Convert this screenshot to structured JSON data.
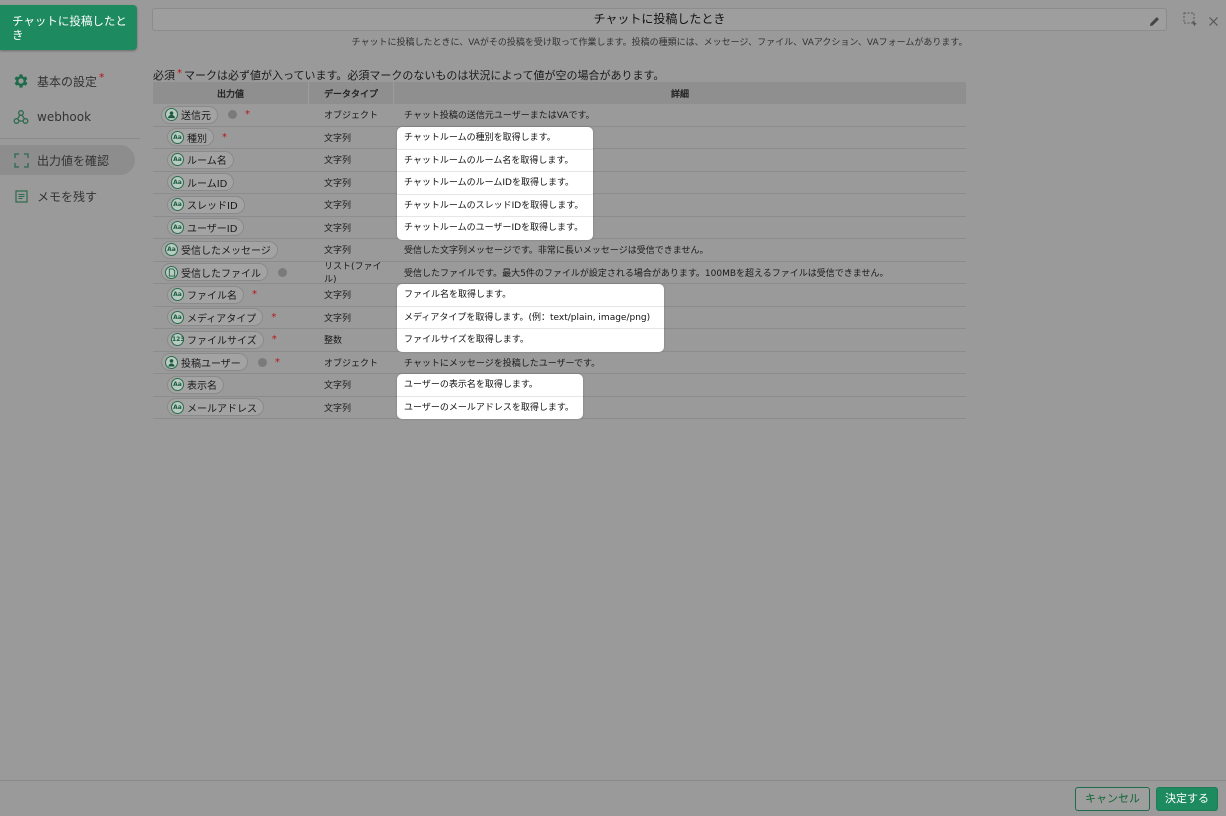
{
  "sidebar": {
    "trigger_title": "チャットに投稿したとき",
    "items": [
      {
        "label": "基本の設定",
        "required_mark": "*"
      },
      {
        "label": "webhook"
      },
      {
        "label": "出力値を確認"
      },
      {
        "label": "メモを残す"
      }
    ]
  },
  "header": {
    "title": "チャットに投稿したとき",
    "subtitle": "チャットに投稿したときに、VAがその投稿を受け取って作業します。投稿の種類には、メッセージ、ファイル、VAアクション、VAフォームがあります。"
  },
  "note": {
    "prefix": "必須",
    "mark": "*",
    "text": "マークは必ず値が入っています。必須マークのないものは状況によって値が空の場合があります。"
  },
  "table": {
    "headers": [
      "出力値",
      "データタイプ",
      "詳細"
    ],
    "rows": [
      {
        "name": "送信元",
        "icon": "group",
        "dot": true,
        "req": "*",
        "type": "オブジェクト",
        "detail": "チャット投稿の送信元ユーザーまたはVAです。",
        "indent": 0
      },
      {
        "name": "種別",
        "icon": "Aa",
        "req": "*",
        "type": "文字列",
        "detail": "",
        "indent": 1
      },
      {
        "name": "ルーム名",
        "icon": "Aa",
        "type": "文字列",
        "detail": "",
        "indent": 1
      },
      {
        "name": "ルームID",
        "icon": "Aa",
        "type": "文字列",
        "detail": "",
        "indent": 1
      },
      {
        "name": "スレッドID",
        "icon": "Aa",
        "type": "文字列",
        "detail": "",
        "indent": 1
      },
      {
        "name": "ユーザーID",
        "icon": "Aa",
        "type": "文字列",
        "detail": "",
        "indent": 1
      },
      {
        "name": "受信したメッセージ",
        "icon": "Aa",
        "type": "文字列",
        "detail": "受信した文字列メッセージです。非常に長いメッセージは受信できません。",
        "indent": 0
      },
      {
        "name": "受信したファイル",
        "icon": "file",
        "dot": true,
        "type": "リスト(ファイル)",
        "detail": "受信したファイルです。最大5件のファイルが設定される場合があります。100MBを超えるファイルは受信できません。",
        "indent": 0
      },
      {
        "name": "ファイル名",
        "icon": "Aa",
        "req": "*",
        "type": "文字列",
        "detail": "",
        "indent": 1
      },
      {
        "name": "メディアタイプ",
        "icon": "Aa",
        "req": "*",
        "type": "文字列",
        "detail": "",
        "indent": 1
      },
      {
        "name": "ファイルサイズ",
        "icon": "123",
        "req": "*",
        "type": "整数",
        "detail": "",
        "indent": 1
      },
      {
        "name": "投稿ユーザー",
        "icon": "user",
        "dot": true,
        "req": "*",
        "type": "オブジェクト",
        "detail": "チャットにメッセージを投稿したユーザーです。",
        "indent": 0
      },
      {
        "name": "表示名",
        "icon": "Aa",
        "type": "文字列",
        "detail": "",
        "indent": 1
      },
      {
        "name": "メールアドレス",
        "icon": "Aa",
        "type": "文字列",
        "detail": "",
        "indent": 1
      }
    ]
  },
  "popups": {
    "room": [
      "チャットルームの種別を取得します。",
      "チャットルームのルーム名を取得します。",
      "チャットルームのルームIDを取得します。",
      "チャットルームのスレッドIDを取得します。",
      "チャットルームのユーザーIDを取得します。"
    ],
    "file": [
      "ファイル名を取得します。",
      "メディアタイプを取得します。(例：text/plain, image/png)",
      "ファイルサイズを取得します。"
    ],
    "user": [
      "ユーザーの表示名を取得します。",
      "ユーザーのメールアドレスを取得します。"
    ]
  },
  "footer": {
    "cancel": "キャンセル",
    "ok": "決定する"
  },
  "colors": {
    "accent": "#1d8a5f",
    "required": "#b81414"
  }
}
